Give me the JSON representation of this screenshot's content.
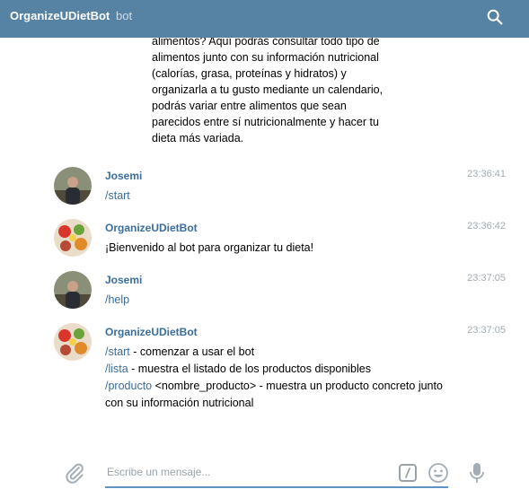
{
  "header": {
    "title": "OrganizeUDietBot",
    "subtitle": "bot",
    "search_icon": "search-icon"
  },
  "intro_lines": [
    "alimentos? Aquí podrás consultar todo tipo de",
    "alimentos junto con su información nutricional",
    "(calorías, grasa, proteínas y hidratos) y",
    "organizarla a tu gusto mediante un calendario,",
    "podrás variar entre alimentos que sean",
    "parecidos entre sí nutricionalmente y hacer tu",
    "dieta más variada."
  ],
  "messages": [
    {
      "sender": "Josemi",
      "time": "23:36:41",
      "text": "/start"
    },
    {
      "sender": "OrganizeUDietBot",
      "time": "23:36:42",
      "text": "¡Bienvenido al bot para organizar tu dieta!"
    },
    {
      "sender": "Josemi",
      "time": "23:37:05",
      "text": "/help"
    },
    {
      "sender": "OrganizeUDietBot",
      "time": "23:37:05",
      "lines": [
        {
          "cmd": "/start",
          "rest": " - comenzar a usar el bot"
        },
        {
          "cmd": "/lista",
          "rest": " - muestra el listado de los productos disponibles"
        },
        {
          "cmd": "/producto",
          "rest": " <nombre_producto> - muestra un producto concreto junto"
        },
        {
          "cmd": "",
          "rest": "con su información nutricional"
        }
      ]
    }
  ],
  "composer": {
    "placeholder": "Escribe un mensaje..."
  },
  "colors": {
    "header": "#5682a3",
    "link": "#3a6d99"
  }
}
